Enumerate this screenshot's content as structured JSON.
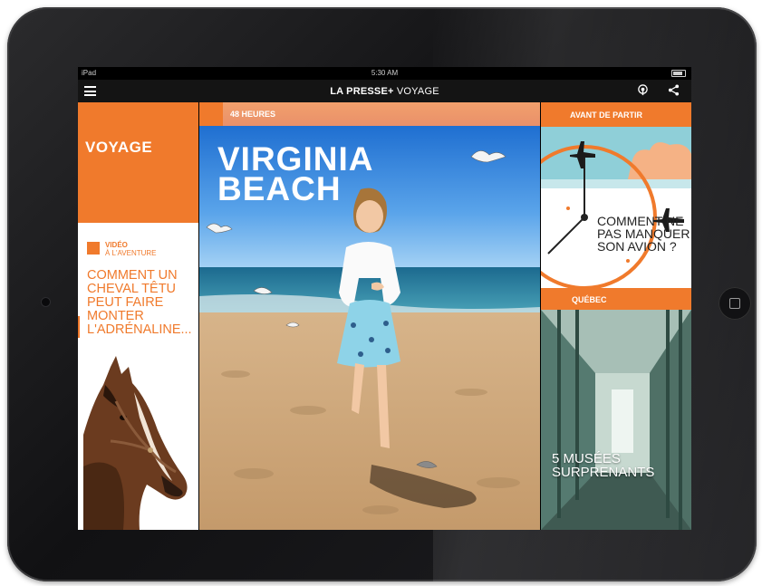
{
  "status_bar": {
    "carrier": "iPad",
    "time": "5:30 AM"
  },
  "navbar": {
    "brand_bold": "LA PRESSE+",
    "brand_section": "VOYAGE"
  },
  "left_column": {
    "section_tile": "VOYAGE",
    "video_tag_line1": "VIDÉO",
    "video_tag_line2": "À L'AVENTURE",
    "headline": "COMMENT UN CHEVAL TÊTU PEUT FAIRE MONTER L'ADRÉNALINE..."
  },
  "center_feature": {
    "label": "48 HEURES",
    "title_line1": "VIRGINIA",
    "title_line2": "BEACH"
  },
  "right_top": {
    "label": "AVANT DE PARTIR",
    "headline": "COMMENT NE PAS MANQUER SON AVION ?"
  },
  "right_bottom": {
    "label": "QUÉBEC",
    "headline_line1": "5 MUSÉES",
    "headline_line2": "SURPRENANTS"
  },
  "icons": {
    "menu": "hamburger-icon",
    "podcast": "podcast-icon",
    "share": "share-icon",
    "home": "home-button-icon"
  },
  "colors": {
    "accent_orange": "#f07a2c",
    "navbar": "#141414",
    "device_bezel": "#1a1a1c"
  }
}
